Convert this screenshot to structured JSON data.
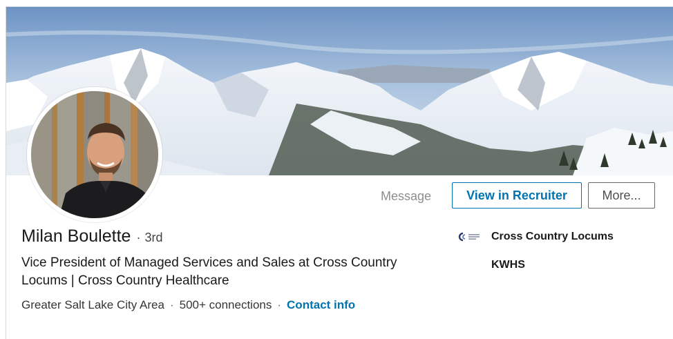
{
  "profile": {
    "name": "Milan Boulette",
    "degree_separator": "·",
    "degree": "3rd",
    "headline": "Vice President of Managed Services and Sales at Cross Country Locums | Cross Country Healthcare",
    "location": "Greater Salt Lake City Area",
    "connections": "500+ connections",
    "meta_separator": "·",
    "contact_info_label": "Contact info"
  },
  "actions": {
    "message_label": "Message",
    "view_recruiter_label": "View in Recruiter",
    "more_label": "More..."
  },
  "experience": {
    "current_company": "Cross Country Locums",
    "current_company_logo": "cross-country-logo",
    "education": "KWHS"
  },
  "colors": {
    "link_blue": "#0073b1",
    "muted_text": "#737373"
  },
  "images": {
    "banner": "snowy-mountain-panorama",
    "avatar": "profile-photo"
  }
}
